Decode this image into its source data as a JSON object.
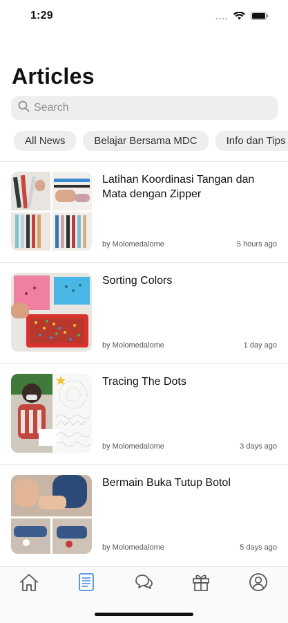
{
  "status": {
    "time": "1:29"
  },
  "header": {
    "title": "Articles"
  },
  "search": {
    "placeholder": "Search"
  },
  "categories": [
    {
      "label": "All News"
    },
    {
      "label": "Belajar Bersama MDC"
    },
    {
      "label": "Info dan Tips"
    }
  ],
  "articles": [
    {
      "title": "Latihan Koordinasi Tangan dan Mata dengan Zipper",
      "author": "by Molomedalome",
      "time": "5 hours ago"
    },
    {
      "title": "Sorting Colors",
      "author": "by Molomedalome",
      "time": "1 day ago"
    },
    {
      "title": "Tracing The Dots",
      "author": "by Molomedalome",
      "time": "3 days ago"
    },
    {
      "title": "Bermain Buka Tutup Botol",
      "author": "by Molomedalome",
      "time": "5 days ago"
    }
  ],
  "tabbar": {
    "items": [
      {
        "icon": "home-icon"
      },
      {
        "icon": "articles-icon"
      },
      {
        "icon": "chat-icon"
      },
      {
        "icon": "gift-icon"
      },
      {
        "icon": "profile-icon"
      }
    ],
    "active_color": "#4a90e2",
    "inactive_color": "#555555"
  }
}
